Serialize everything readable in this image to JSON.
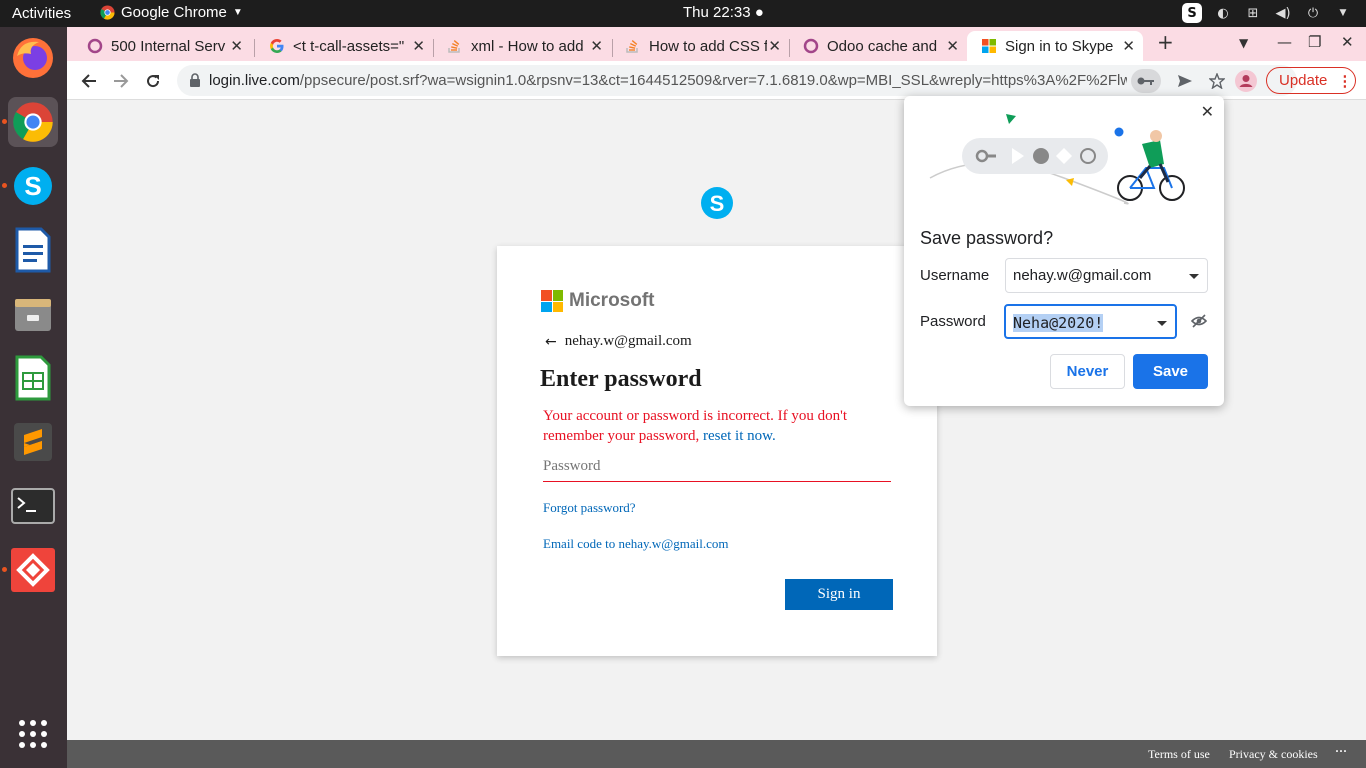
{
  "topbar": {
    "activities": "Activities",
    "app_name": "Google Chrome",
    "clock": "Thu 22:33"
  },
  "tabs": [
    {
      "title": "500 Internal Serv",
      "icon": "odoo-circle-icon"
    },
    {
      "title": "<t t-call-assets=\"",
      "icon": "google-g-icon"
    },
    {
      "title": "xml - How to add",
      "icon": "stackoverflow-icon"
    },
    {
      "title": "How to add CSS f",
      "icon": "stackoverflow-icon"
    },
    {
      "title": "Odoo cache and",
      "icon": "odoo-circle-icon"
    },
    {
      "title": "Sign in to Skype",
      "icon": "microsoft-icon",
      "active": true
    }
  ],
  "toolbar": {
    "url_host": "login.live.com",
    "url_path": "/ppsecure/post.srf?wa=wsignin1.0&rpsnv=13&ct=1644512509&rver=7.1.6819.0&wp=MBI_SSL&wreply=https%3A%2F%2Flw.skyp...",
    "update_label": "Update"
  },
  "signin": {
    "brand": "Microsoft",
    "identity": "nehay.w@gmail.com",
    "heading": "Enter password",
    "error_text": "Your account or password is incorrect. If you don't remember your password,",
    "error_link": "reset it now.",
    "password_placeholder": "Password",
    "forgot_link": "Forgot password?",
    "email_code_link": "Email code to nehay.w@gmail.com",
    "signin_button": "Sign in"
  },
  "footer": {
    "terms": "Terms of use",
    "privacy": "Privacy & cookies",
    "more": "···"
  },
  "save_password": {
    "title": "Save password?",
    "username_label": "Username",
    "username_value": "nehay.w@gmail.com",
    "password_label": "Password",
    "password_value": "Neha@2020!",
    "never_button": "Never",
    "save_button": "Save"
  },
  "colors": {
    "accent": "#1a73e8",
    "ms_blue": "#0067b8",
    "error_red": "#e81123",
    "tab_bar": "#fbdce4"
  }
}
